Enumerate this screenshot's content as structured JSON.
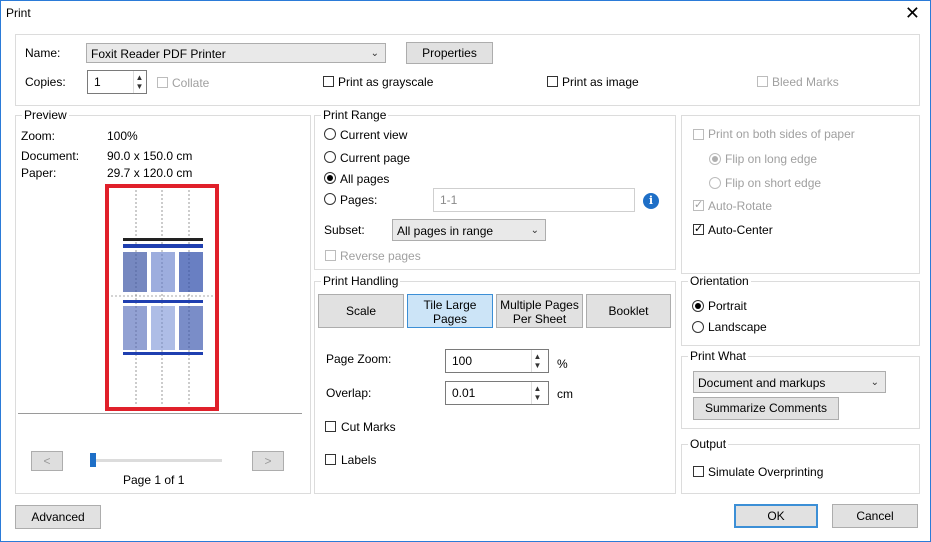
{
  "window": {
    "title": "Print",
    "close": "✕"
  },
  "printer": {
    "name_label": "Name:",
    "name_value": "Foxit Reader PDF Printer",
    "properties": "Properties",
    "copies_label": "Copies:",
    "copies_value": "1",
    "collate": "Collate",
    "grayscale": "Print as grayscale",
    "as_image": "Print as image",
    "bleed": "Bleed Marks"
  },
  "preview": {
    "legend": "Preview",
    "zoom_label": "Zoom:",
    "zoom_value": "100%",
    "document_label": "Document:",
    "document_value": "90.0 x 150.0 cm",
    "paper_label": "Paper:",
    "paper_value": "29.7 x 120.0 cm",
    "prev": "<",
    "next": ">",
    "page": "Page 1 of 1"
  },
  "range": {
    "legend": "Print Range",
    "current_view": "Current view",
    "current_page": "Current page",
    "all_pages": "All pages",
    "pages": "Pages:",
    "pages_value": "1-1",
    "info": "i",
    "subset_label": "Subset:",
    "subset_value": "All pages in range",
    "reverse": "Reverse pages"
  },
  "handling": {
    "legend": "Print Handling",
    "scale": "Scale",
    "tile_1": "Tile Large",
    "tile_2": "Pages",
    "multi_1": "Multiple Pages",
    "multi_2": "Per Sheet",
    "booklet": "Booklet",
    "zoom_label": "Page Zoom:",
    "zoom_value": "100",
    "zoom_unit": "%",
    "overlap_label": "Overlap:",
    "overlap_value": "0.01",
    "overlap_unit": "cm",
    "cut_marks": "Cut Marks",
    "labels": "Labels"
  },
  "duplex": {
    "both_sides": "Print on both sides of paper",
    "long_edge": "Flip on long edge",
    "short_edge": "Flip on short edge",
    "auto_rotate": "Auto-Rotate",
    "auto_center": "Auto-Center"
  },
  "orientation": {
    "legend": "Orientation",
    "portrait": "Portrait",
    "landscape": "Landscape"
  },
  "what": {
    "legend": "Print What",
    "value": "Document and markups",
    "summarize": "Summarize Comments"
  },
  "output": {
    "legend": "Output",
    "simulate": "Simulate Overprinting"
  },
  "footer": {
    "advanced": "Advanced",
    "ok": "OK",
    "cancel": "Cancel"
  },
  "spin_glyph": "▲▼",
  "arrow_glyph": "⌄",
  "colors": {
    "accent": "#3c8fd6",
    "preview_border": "#e0202a",
    "info_icon": "#1e6fc7"
  }
}
